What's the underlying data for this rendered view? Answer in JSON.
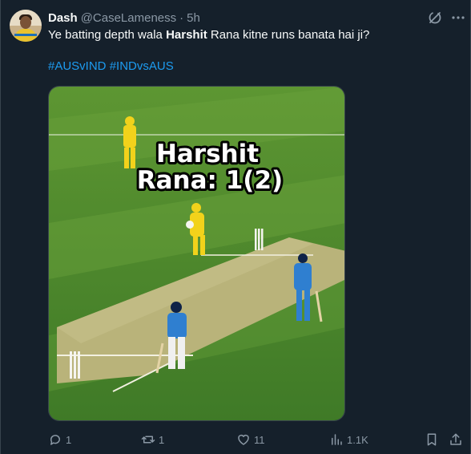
{
  "tweet": {
    "author_name": "Dash",
    "author_handle": "@CaseLameness",
    "separator": "·",
    "time": "5h",
    "text_before": "Ye batting depth wala ",
    "text_bold": "Harshit",
    "text_after": " Rana kitne runs banata hai ji?",
    "hashtags": [
      "#AUSvIND",
      "#INDvsAUS"
    ]
  },
  "media": {
    "overlay_line1": "Harshit",
    "overlay_line2": "Rana: 1(2)"
  },
  "actions": {
    "replies": "1",
    "reposts": "1",
    "likes": "11",
    "views": "1.1K"
  },
  "colors": {
    "background": "#15202b",
    "accent": "#1d9bf0",
    "muted": "#8b98a5",
    "field_green": "#4d8a2e",
    "pitch": "#b9b37a",
    "aus_kit": "#f2d21b",
    "ind_kit": "#2f7fd0"
  },
  "icons": [
    "grok-icon",
    "more-icon",
    "reply-icon",
    "repost-icon",
    "like-icon",
    "views-icon",
    "bookmark-icon",
    "share-icon"
  ]
}
